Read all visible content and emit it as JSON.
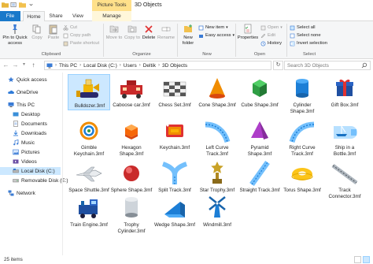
{
  "window": {
    "title": "3D Objects",
    "context_tab": "Picture Tools"
  },
  "tabs": [
    "File",
    "Home",
    "Share",
    "View",
    "Manage"
  ],
  "ribbon": {
    "clipboard": {
      "pin": "Pin to Quick access",
      "copy": "Copy",
      "paste": "Paste",
      "cut": "Cut",
      "copy_path": "Copy path",
      "paste_shortcut": "Paste shortcut",
      "label": "Clipboard"
    },
    "organize": {
      "move_to": "Move to",
      "copy_to": "Copy to",
      "delete": "Delete",
      "rename": "Rename",
      "label": "Organize"
    },
    "new": {
      "new_folder": "New folder",
      "new_item": "New item",
      "easy_access": "Easy access",
      "label": "New"
    },
    "open": {
      "properties": "Properties",
      "open": "Open",
      "edit": "Edit",
      "history": "History",
      "label": "Open"
    },
    "select": {
      "select_all": "Select all",
      "select_none": "Select none",
      "invert": "Invert selection",
      "label": "Select"
    }
  },
  "address": {
    "crumbs": [
      "This PC",
      "Local Disk (C:)",
      "Users",
      "Deltik",
      "3D Objects"
    ],
    "search_placeholder": "Search 3D Objects"
  },
  "nav": [
    {
      "label": "Quick access",
      "icon": "star-icon"
    },
    {
      "label": "OneDrive",
      "icon": "cloud-icon"
    },
    {
      "label": "This PC",
      "icon": "computer-icon"
    },
    {
      "label": "Desktop",
      "icon": "desktop-folder-icon"
    },
    {
      "label": "Documents",
      "icon": "documents-folder-icon"
    },
    {
      "label": "Downloads",
      "icon": "downloads-folder-icon"
    },
    {
      "label": "Music",
      "icon": "music-folder-icon"
    },
    {
      "label": "Pictures",
      "icon": "pictures-folder-icon"
    },
    {
      "label": "Videos",
      "icon": "videos-folder-icon"
    },
    {
      "label": "Local Disk (C:)",
      "icon": "drive-icon"
    },
    {
      "label": "Removable Disk (E:)",
      "icon": "removable-drive-icon"
    },
    {
      "label": "Network",
      "icon": "network-icon"
    }
  ],
  "files": [
    {
      "label": "Bulldozer.3mf"
    },
    {
      "label": "Caboose car.3mf"
    },
    {
      "label": "Chess Set.3mf"
    },
    {
      "label": "Cone Shape.3mf"
    },
    {
      "label": "Cube Shape.3mf"
    },
    {
      "label": "Cylinder Shape.3mf"
    },
    {
      "label": "Gift Box.3mf"
    },
    {
      "label": "Gimble Keychain.3mf"
    },
    {
      "label": "Hexagon Shape.3mf"
    },
    {
      "label": "Keychain.3mf"
    },
    {
      "label": "Left Curve Track.3mf"
    },
    {
      "label": "Pyramid Shape.3mf"
    },
    {
      "label": "Right Curve Track.3mf"
    },
    {
      "label": "Ship in a Bottle.3mf"
    },
    {
      "label": "Space Shuttle.3mf"
    },
    {
      "label": "Sphere Shape.3mf"
    },
    {
      "label": "Split Track.3mf"
    },
    {
      "label": "Star Trophy.3mf"
    },
    {
      "label": "Straight Track.3mf"
    },
    {
      "label": "Torus Shape.3mf"
    },
    {
      "label": "Track Connector.3mf"
    },
    {
      "label": "Train Engine.3mf"
    },
    {
      "label": "Trophy Cylinder.3mf"
    },
    {
      "label": "Wedge Shape.3mf"
    },
    {
      "label": "Windmill.3mf"
    }
  ],
  "status": {
    "count": "25 items"
  }
}
